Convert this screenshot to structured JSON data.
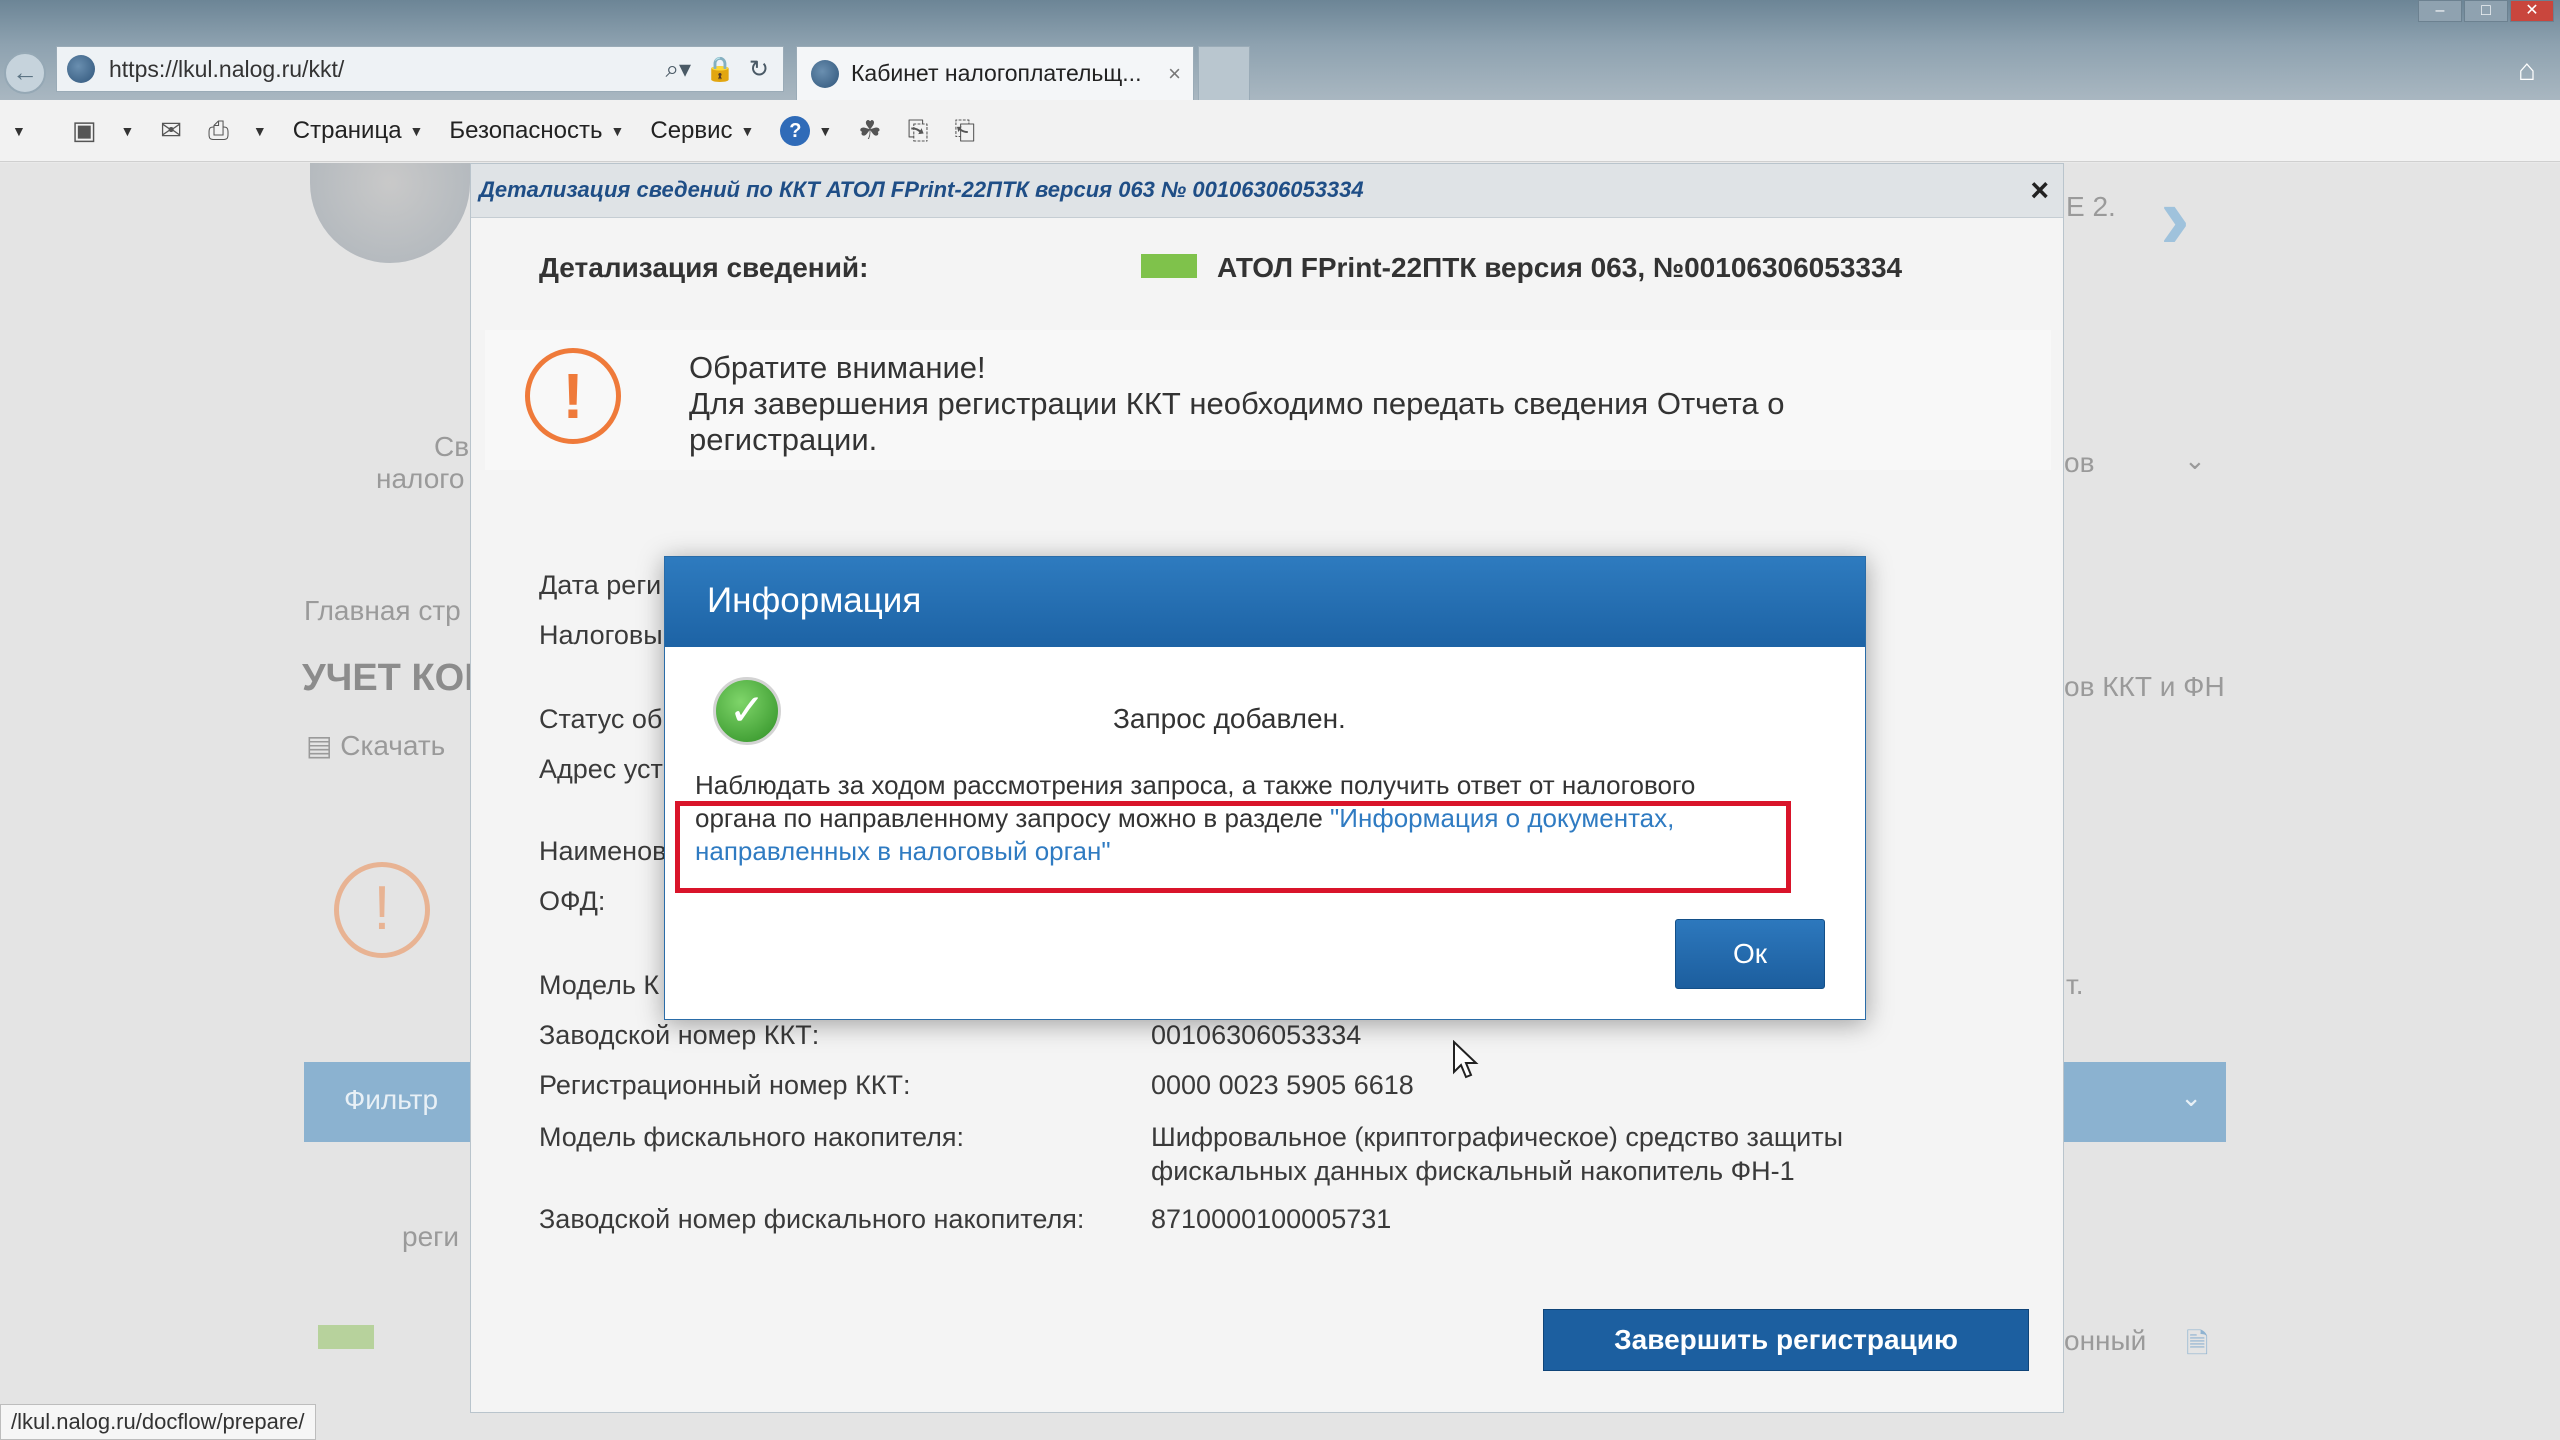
{
  "browser": {
    "url": "https://lkul.nalog.ru/kkt/",
    "tab_title": "Кабинет налогоплательщ...",
    "tab_close": "×",
    "status_url": "/lkul.nalog.ru/docflow/prepare/",
    "command_bar": {
      "page": "Страница",
      "security": "Безопасность",
      "service": "Сервис",
      "help": "?"
    }
  },
  "background": {
    "fragments": {
      "sidebar_1": "Св",
      "sidebar_2": "налого",
      "breadcrumb": "Главная стр",
      "heading": "УЧЕТ КОНТ",
      "download": "Скачать",
      "filter": "Фильтр",
      "right_ov": "ов",
      "right_kkt": "ов ККТ и ФН",
      "right_e2": "Е 2.",
      "right_t": "т.",
      "right_onny": "онный",
      "left_reg": "реги"
    }
  },
  "detail_dialog": {
    "title": "Детализация сведений по ККТ АТОЛ FPrint-22ПТК версия 063 № 00106306053334",
    "close": "×",
    "header_label": "Детализация сведений:",
    "header_model": "АТОЛ FPrint-22ПТК версия 063, №00106306053334",
    "notice": {
      "title": "Обратите внимание!",
      "text": "Для завершения регистрации ККТ необходимо передать сведения Отчета о регистрации."
    },
    "fields": [
      {
        "label": "Дата реги",
        "value": ""
      },
      {
        "label": "Налоговы",
        "value": ""
      },
      {
        "label": "Статус об",
        "value": ""
      },
      {
        "label": "Адрес уст",
        "value": ""
      },
      {
        "label": "Наименов",
        "value": ""
      },
      {
        "label": "ОФД:",
        "value": ""
      },
      {
        "label": "Модель К",
        "value": ""
      },
      {
        "label": "Заводской номер ККТ:",
        "value": "00106306053334"
      },
      {
        "label": "Регистрационный номер ККТ:",
        "value": "0000 0023 5905 6618"
      },
      {
        "label": "Модель фискального накопителя:",
        "value": "Шифровальное (криптографическое) средство защиты фискальных данных фискальный накопитель ФН-1"
      },
      {
        "label": "Заводской номер фискального накопителя:",
        "value": "8710000100005731"
      }
    ],
    "finish_button": "Завершить регистрацию"
  },
  "info_modal": {
    "title": "Информация",
    "status": "Запрос добавлен.",
    "body_line1": "Наблюдать за ходом рассмотрения запроса, а также получить ответ от налогового",
    "body_line2": "органа по направленному запросу можно в разделе ",
    "link_text": "\"Информация о документах, направленных в налоговый орган\"",
    "ok_button": "Ок"
  },
  "colors": {
    "modal_header": "#1d63a5",
    "highlight": "#d9142a",
    "warning": "#ef7a3a",
    "success": "#2e8f24",
    "link": "#2f7bc2"
  }
}
